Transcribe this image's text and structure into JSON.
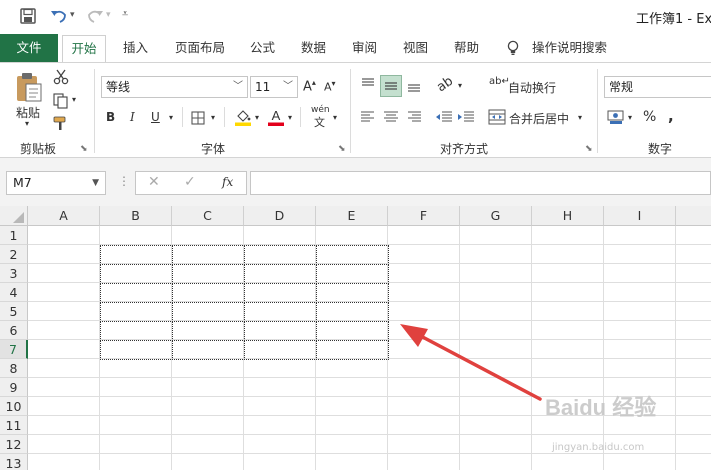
{
  "window": {
    "title": "工作簿1 - Ex"
  },
  "tabs": {
    "items": [
      "文件",
      "开始",
      "插入",
      "页面布局",
      "公式",
      "数据",
      "审阅",
      "视图",
      "帮助"
    ],
    "tell_me": "操作说明搜索"
  },
  "ribbon": {
    "clipboard": {
      "paste_label": "粘贴",
      "group_label": "剪贴板"
    },
    "font": {
      "font_name": "等线",
      "font_size": "11",
      "group_label": "字体",
      "bold": "B",
      "italic": "I",
      "underline": "U",
      "phonetic": "wén"
    },
    "alignment": {
      "wrap_text": "自动换行",
      "merge_center": "合并后居中",
      "group_label": "对齐方式"
    },
    "number": {
      "format": "常规",
      "percent": "%",
      "comma": ",",
      "group_label": "数字"
    }
  },
  "formula_bar": {
    "name_box": "M7",
    "fx": "fx",
    "value": ""
  },
  "sheet": {
    "columns": [
      "A",
      "B",
      "C",
      "D",
      "E",
      "F",
      "G",
      "H",
      "I"
    ],
    "rows": [
      "1",
      "2",
      "3",
      "4",
      "5",
      "6",
      "7",
      "8",
      "9",
      "10",
      "11",
      "12",
      "13"
    ],
    "active_row": "7",
    "bordered_range": "B2:E7"
  },
  "watermark": {
    "text": "Baidu 经验",
    "url": "jingyan.baidu.com"
  },
  "colors": {
    "accent": "#217346",
    "arrow": "#e0413e",
    "font_color_bar": "#e3001b",
    "fill_color_bar": "#ffd800"
  }
}
